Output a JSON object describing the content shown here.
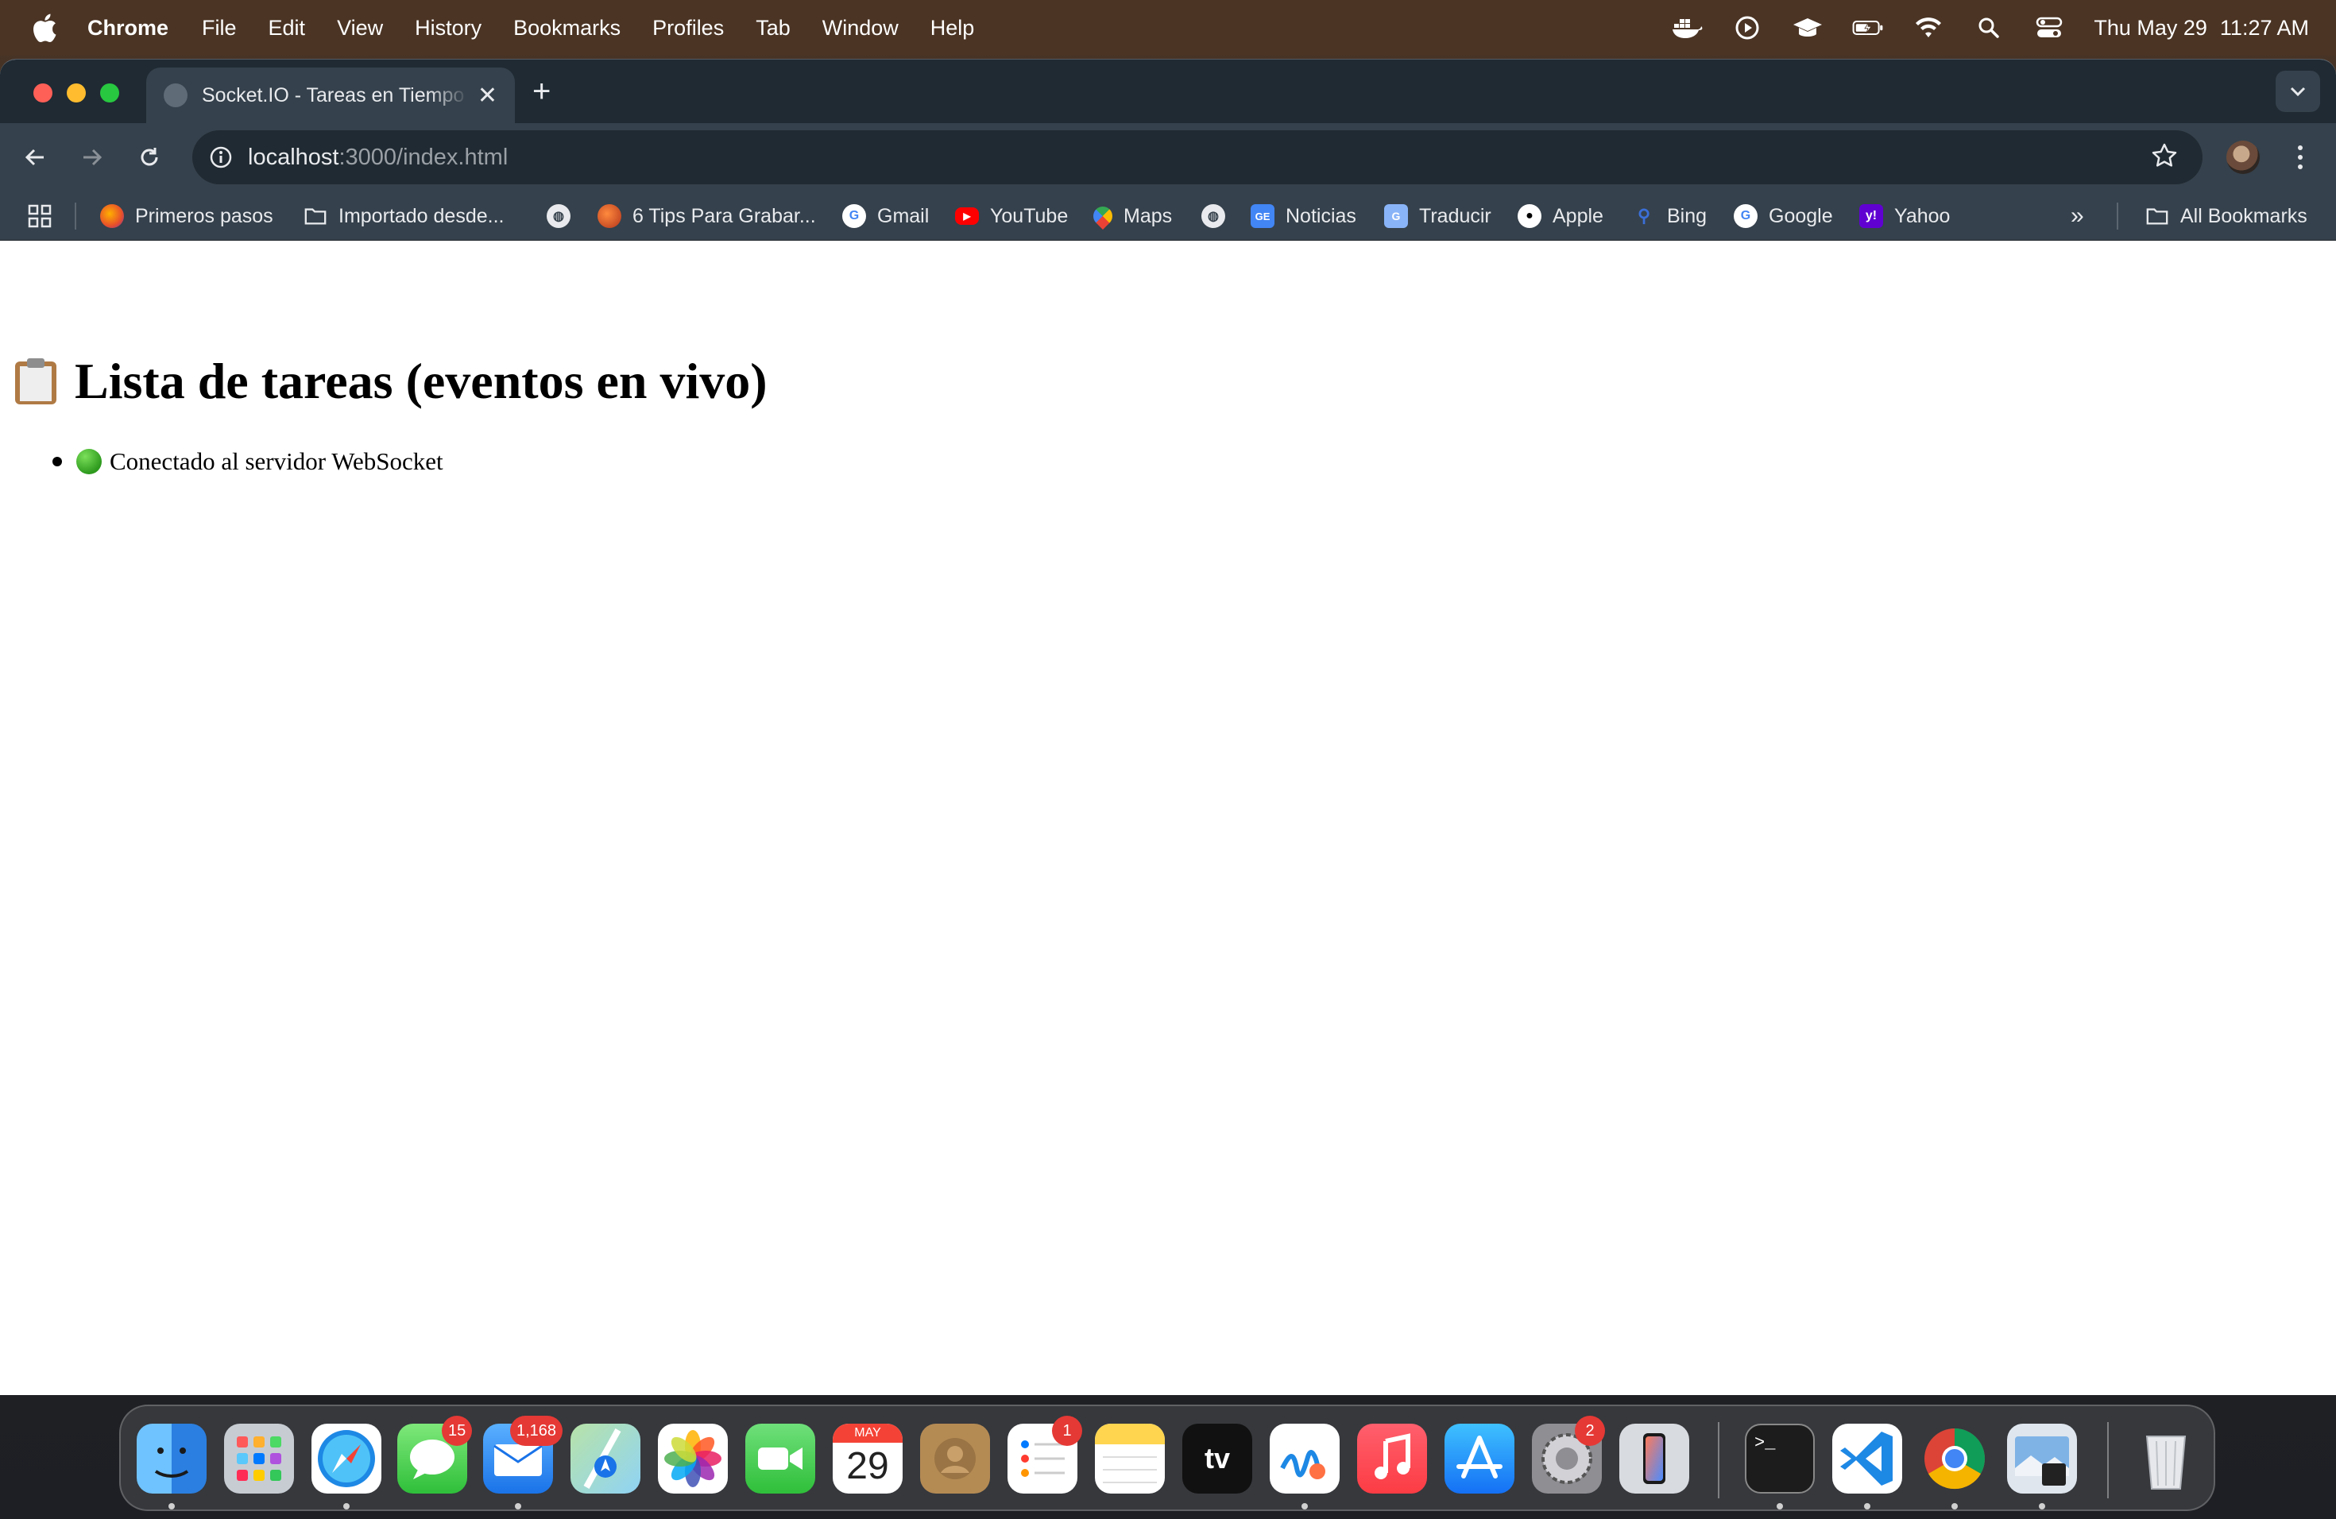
{
  "menubar": {
    "app_name": "Chrome",
    "menus": [
      "File",
      "Edit",
      "View",
      "History",
      "Bookmarks",
      "Profiles",
      "Tab",
      "Window",
      "Help"
    ],
    "date": "Thu May 29",
    "time": "11:27 AM"
  },
  "browser": {
    "tab_title": "Socket.IO - Tareas en Tiempo Real",
    "url_host": "localhost",
    "url_path": ":3000/index.html",
    "bookmarks": [
      {
        "label": "Primeros pasos",
        "icon": "firefox-icon"
      },
      {
        "label": "Importado desde...",
        "icon": "folder-icon"
      },
      {
        "label": "",
        "icon": "globe-icon"
      },
      {
        "label": "6 Tips Para Grabar...",
        "icon": "site-icon"
      },
      {
        "label": "Gmail",
        "icon": "google-icon"
      },
      {
        "label": "YouTube",
        "icon": "youtube-icon"
      },
      {
        "label": "Maps",
        "icon": "maps-icon"
      },
      {
        "label": "",
        "icon": "globe-icon"
      },
      {
        "label": "Noticias",
        "icon": "news-icon"
      },
      {
        "label": "Traducir",
        "icon": "translate-icon"
      },
      {
        "label": "Apple",
        "icon": "apple-icon"
      },
      {
        "label": "Bing",
        "icon": "bing-icon"
      },
      {
        "label": "Google",
        "icon": "google-icon"
      },
      {
        "label": "Yahoo",
        "icon": "yahoo-icon"
      }
    ],
    "all_bookmarks_label": "All Bookmarks"
  },
  "page": {
    "heading": "Lista de tareas (eventos en vivo)",
    "events": [
      "Conectado al servidor WebSocket"
    ]
  },
  "dock": {
    "messages_badge": "15",
    "mail_badge": "1,168",
    "calendar_month": "MAY",
    "calendar_day": "29",
    "reminders_badge": "1",
    "settings_badge": "2"
  }
}
